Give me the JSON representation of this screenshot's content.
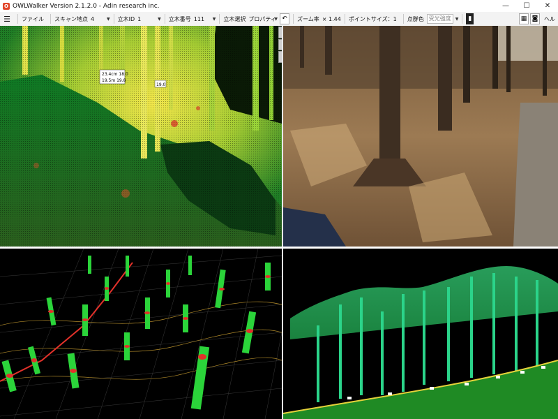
{
  "window": {
    "title": "OWLWalker Version 2.1.2.0 - Adin research inc.",
    "icon": "owl-app-icon",
    "minimize": "—",
    "maximize": "☐",
    "close": "✕"
  },
  "toolbar": {
    "file_menu": "ファイル",
    "scan_point_label": "スキャン地点",
    "scan_point_value": "4",
    "tree_id_label": "立木ID",
    "tree_id_value": "1",
    "tree_number_label": "立木番号",
    "tree_number_value": "111",
    "tree_select_label": "立木選択",
    "tree_select_value": "プロパティ",
    "zoom_label": "ズーム率",
    "zoom_value": "× 1.44",
    "point_size_label": "ポイントサイズ：1",
    "point_color_label": "点群色",
    "point_color_value": "受光強度",
    "help_label": "ヘル"
  },
  "panes": {
    "top_left": "point-cloud-close-view",
    "top_right": "photo-view",
    "bottom_left": "point-cloud-3d-terrain-view",
    "bottom_right": "point-cloud-side-view"
  },
  "labels": {
    "tl_tag1_line1": "23.4cm 18.0",
    "tl_tag1_line2": "19.5m 19.8",
    "tl_tag2": "19.0"
  },
  "colors": {
    "pointcloud_green": "#2bd43a",
    "pointcloud_yellow": "#d8e83a",
    "pointcloud_red": "#d8402a",
    "background_black": "#000000",
    "path_red": "#e2312a"
  }
}
